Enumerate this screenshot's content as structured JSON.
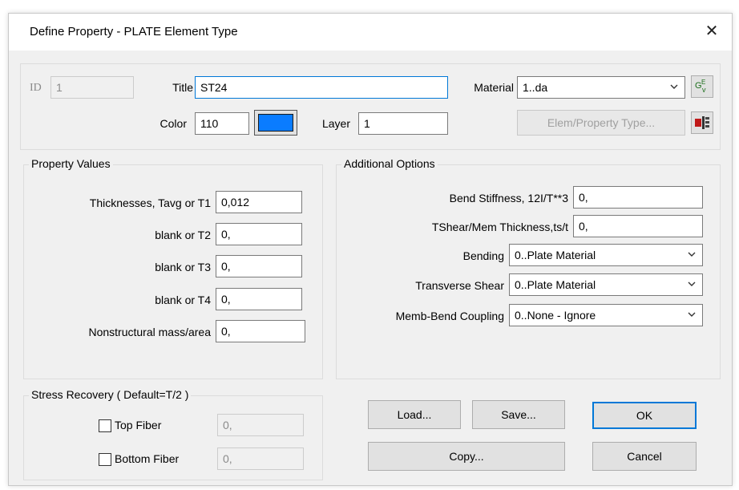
{
  "dialog": {
    "title": "Define Property - PLATE Element Type",
    "close_glyph": "✕"
  },
  "header": {
    "id_label": "ID",
    "id_value": "1",
    "title_label": "Title",
    "title_value": "ST24",
    "material_label": "Material",
    "material_value": "1..da",
    "color_label": "Color",
    "color_value": "110",
    "color_swatch": "#0a7cff",
    "layer_label": "Layer",
    "layer_value": "1",
    "elem_type_button": "Elem/Property Type...",
    "material_icon_text": "GE",
    "material_icon_sub": "v",
    "elem_icon": "element-type-icon"
  },
  "property_values": {
    "title": "Property Values",
    "rows": [
      {
        "label": "Thicknesses, Tavg or T1",
        "value": "0,012"
      },
      {
        "label": "blank or T2",
        "value": "0,"
      },
      {
        "label": "blank or T3",
        "value": "0,"
      },
      {
        "label": "blank or T4",
        "value": "0,"
      },
      {
        "label": "Nonstructural mass/area",
        "value": "0,"
      }
    ]
  },
  "additional_options": {
    "title": "Additional Options",
    "bend_stiffness_label": "Bend Stiffness,  12I/T**3",
    "bend_stiffness_value": "0,",
    "tshear_label": "TShear/Mem Thickness,ts/t",
    "tshear_value": "0,",
    "bending_label": "Bending",
    "bending_value": "0..Plate Material",
    "transverse_label": "Transverse Shear",
    "transverse_value": "0..Plate Material",
    "coupling_label": "Memb-Bend Coupling",
    "coupling_value": "0..None - Ignore"
  },
  "stress_recovery": {
    "title": "Stress Recovery ( Default=T/2 )",
    "top_label": "Top Fiber",
    "top_value": "0,",
    "bottom_label": "Bottom Fiber",
    "bottom_value": "0,"
  },
  "buttons": {
    "load": "Load...",
    "save": "Save...",
    "ok": "OK",
    "copy": "Copy...",
    "cancel": "Cancel"
  },
  "colors": {
    "dialog_bg": "#f0f0f0",
    "focus_border": "#0078d7"
  }
}
